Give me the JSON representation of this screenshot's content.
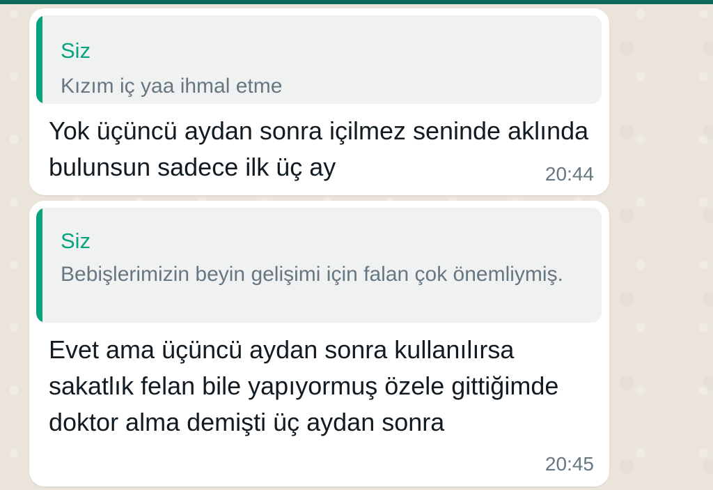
{
  "theme": {
    "accent": "#0b6b58",
    "quote_accent": "#06a37d",
    "bubble_bg": "#ffffff",
    "chat_bg": "#ebe4da"
  },
  "messages": [
    {
      "quote_author": "Siz",
      "quote_text": "Kızım iç yaa ihmal etme",
      "text": "Yok üçüncü aydan sonra içilmez seninde aklında bulunsun sadece ilk üç ay",
      "time": "20:44"
    },
    {
      "quote_author": "Siz",
      "quote_text": "Bebişlerimizin beyin gelişimi için falan çok önemliymiş.",
      "text": "Evet ama üçüncü aydan sonra kullanılırsa sakatlık felan bile yapıyormuş özele gittiğimde doktor alma demişti üç aydan sonra",
      "time": "20:45"
    }
  ]
}
